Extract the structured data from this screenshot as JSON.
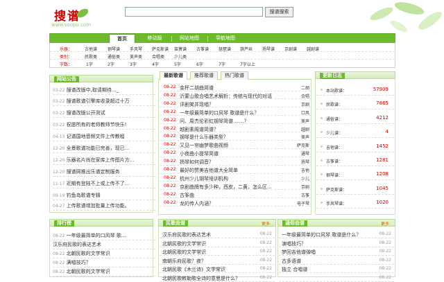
{
  "logo": {
    "text": "搜谱",
    "url": "www.soopu.com"
  },
  "search": {
    "placeholder": "",
    "button": "搜谱搜索"
  },
  "nav": {
    "tabs": [
      "首页",
      "移动版",
      "网站地图",
      "导航地图"
    ]
  },
  "categories": {
    "rows": [
      {
        "label": " 乐器：",
        "items": [
          "古他谱",
          "钢琴谱",
          "手风琴",
          "萨克斯谱",
          "笛箫谱",
          "古筝谱",
          "琵琶谱",
          "葫芦丝",
          "扬琴谱",
          "京剧谱",
          "越剧谱"
        ]
      },
      {
        "label": "类别：",
        "items": [
          "民歌类",
          "通俗类",
          "美声类",
          "合唱类",
          "少儿类"
        ]
      },
      {
        "label": "字数：",
        "items": [
          "1字",
          "2字",
          "3字",
          "4字",
          "5字",
          "6字",
          "7字",
          "7字以上"
        ]
      }
    ]
  },
  "announce": {
    "title": "网站公告",
    "items": [
      {
        "date": "03-22",
        "text": "搜谱改版中,取请期待..._"
      },
      {
        "date": "03-22",
        "text": "搜谱歌谱引擎库收录超过十万"
      },
      {
        "date": "03-22",
        "text": "搜谱改版公开测试"
      },
      {
        "date": "03-22",
        "text": "祝愿所有的老师教师节快乐!"
      },
      {
        "date": "04-13",
        "text": "记谱国地音频文件上传教程"
      },
      {
        "date": "12-20",
        "text": "全景歌谱功能已完善，现已..."
      },
      {
        "date": "12-20",
        "text": "乐器名片尚在家库上传图片方..."
      },
      {
        "date": "12-20",
        "text": "搜谱网推出乐谱定制服务"
      },
      {
        "date": "11-17",
        "text": "近期有登陆不上或上传不了..."
      },
      {
        "date": "09-19",
        "text": "钓鱼岛歌谱专辑"
      },
      {
        "date": "04-27",
        "text": "上传歌谱增加批量上传功能。"
      }
    ]
  },
  "ranking": {
    "title": "排行榜",
    "items": [
      {
        "date": "08-22",
        "text": "一年级最简单的口风琴 歌..."
      },
      {
        "date": "",
        "text": "汉乐府民歌的表达艺术"
      },
      {
        "date": "08-22",
        "text": "北朝民歌的文学常识"
      },
      {
        "date": "08-22",
        "text": "满唱技巧？"
      },
      {
        "date": "08-22",
        "text": "北朝民歌的文学常识"
      },
      {
        "date": "08-22",
        "text": "梦回吉他谱弹唱"
      }
    ]
  },
  "center": {
    "tabs": [
      "最新歌谱",
      "推荐歌谱",
      "热门歌谱"
    ],
    "rows": [
      {
        "date": "08-22",
        "title": "金杯二胡曲简谱",
        "cat": "二胡"
      },
      {
        "date": "08-22",
        "title": "沂蒙山歌合唱艺术解析：传统与现代的对话",
        "cat": "合唱"
      },
      {
        "date": "08-22",
        "title": "评剧笑并现唱？",
        "cat": "京剧"
      },
      {
        "date": "08-22",
        "title": "一年级最简单的口风琴 歌谱是什么？",
        "cat": "口风"
      },
      {
        "date": "08-22",
        "title": "问、周杰伦彩虹钢琴简谱.......？",
        "cat": "美声"
      },
      {
        "date": "08-22",
        "title": "越剧素阁谱简谱？",
        "cat": "越剧"
      },
      {
        "date": "08-22",
        "title": "钢琴是什么乐器类型？",
        "cat": "美声"
      },
      {
        "date": "08-22",
        "title": "又见一帘幽梦歌曲视频",
        "cat": "萨克斯"
      },
      {
        "date": "08-22",
        "title": "小夜曲小提琴简谱",
        "cat": "通琴"
      },
      {
        "date": "08-22",
        "title": "扬琴如何调音？",
        "cat": "扬琴"
      },
      {
        "date": "08-22",
        "title": "最好的赞美吉他谱大全简单",
        "cat": "吉他"
      },
      {
        "date": "08-22",
        "title": "杭州少儿钢琴培训机构",
        "cat": "少儿"
      },
      {
        "date": "08-22",
        "title": "京剧曲牌有多少种，西皮，二黄，怎么区...",
        "cat": "京剧"
      },
      {
        "date": "08-22",
        "title": "古筝曲",
        "cat": "古筝"
      },
      {
        "date": "08-22",
        "title": "龙的传人内涵？",
        "cat": "电子琴"
      }
    ]
  },
  "updates": {
    "title": "更新日志",
    "items": [
      {
        "name": "本站歌谱：",
        "count": "57909"
      },
      {
        "name": "民歌谱：",
        "count": "7865"
      },
      {
        "name": "通俗谱：",
        "count": "4212"
      },
      {
        "name": "少儿谱：",
        "count": "4"
      },
      {
        "name": "吉他谱：",
        "count": "1452"
      },
      {
        "name": "古筝谱：",
        "count": "1281"
      },
      {
        "name": "钢琴谱：",
        "count": "1208"
      },
      {
        "name": "萨克斯谱：",
        "count": "1045"
      },
      {
        "name": "手风琴谱：",
        "count": "1020"
      }
    ]
  },
  "folk": {
    "title": "民歌曲谱",
    "more": "更多",
    "items": [
      {
        "title": "汉乐府民歌的表达艺术",
        "date": "08-22"
      },
      {
        "title": "北朝民歌的文学常识",
        "date": "08-22"
      },
      {
        "title": "北朝民歌的文学常识",
        "date": "08-22"
      },
      {
        "title": "南朝乐府民歌？夜？",
        "date": "08-22"
      },
      {
        "title": "北朝民歌《木兰诗》文学常识",
        "date": "08-22"
      },
      {
        "title": "北朝民歌敕勒歌全诗的意思是什么？",
        "date": "08-22"
      }
    ]
  },
  "popular": {
    "title": "通俗曲谱",
    "more": "更多",
    "items": [
      {
        "title": "一年级最简单的口风琴 歌谱是什么？",
        "date": "08-22"
      },
      {
        "title": "演唱技巧？",
        "date": "08-22"
      },
      {
        "title": "梦回吉他谱弹唱",
        "date": "08-22"
      },
      {
        "title": "古多语谱",
        "date": "08-22"
      },
      {
        "title": "独立 合唱谱",
        "date": "08-22"
      },
      {
        "title": "",
        "date": "08-22"
      }
    ]
  }
}
